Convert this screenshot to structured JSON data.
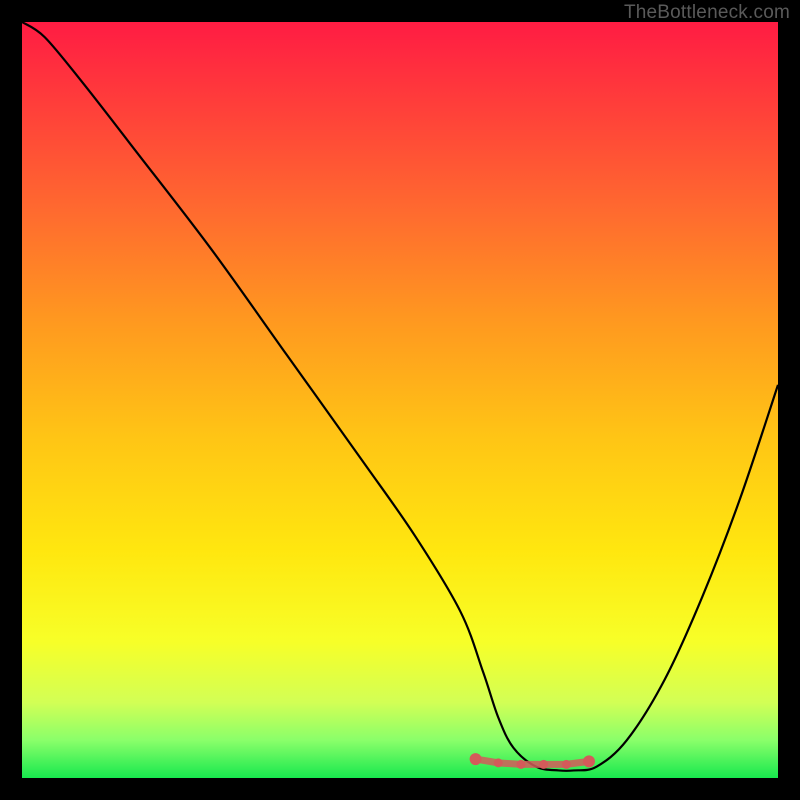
{
  "chart_data": {
    "type": "line",
    "title": "",
    "xlabel": "",
    "ylabel": "",
    "xlim": [
      0,
      100
    ],
    "ylim": [
      0,
      100
    ],
    "watermark": "TheBottleneck.com",
    "series": [
      {
        "name": "bottleneck-curve",
        "x": [
          0,
          3,
          8,
          15,
          25,
          35,
          45,
          52,
          58,
          61,
          63,
          65,
          68,
          71,
          73,
          76,
          80,
          85,
          90,
          95,
          100
        ],
        "values": [
          100,
          98,
          92,
          83,
          70,
          56,
          42,
          32,
          22,
          14,
          8,
          4,
          1.5,
          1,
          1,
          1.5,
          5,
          13,
          24,
          37,
          52
        ]
      }
    ],
    "markers": {
      "name": "bottom-markers",
      "color": "#d45a5a",
      "points": [
        {
          "x": 60,
          "y": 2.5
        },
        {
          "x": 63,
          "y": 2.0
        },
        {
          "x": 66,
          "y": 1.8
        },
        {
          "x": 69,
          "y": 1.8
        },
        {
          "x": 72,
          "y": 1.8
        },
        {
          "x": 75,
          "y": 2.2
        }
      ]
    },
    "gradient": {
      "top": "#ff1c43",
      "mid": "#ffe70f",
      "bottom": "#17e84e"
    }
  }
}
